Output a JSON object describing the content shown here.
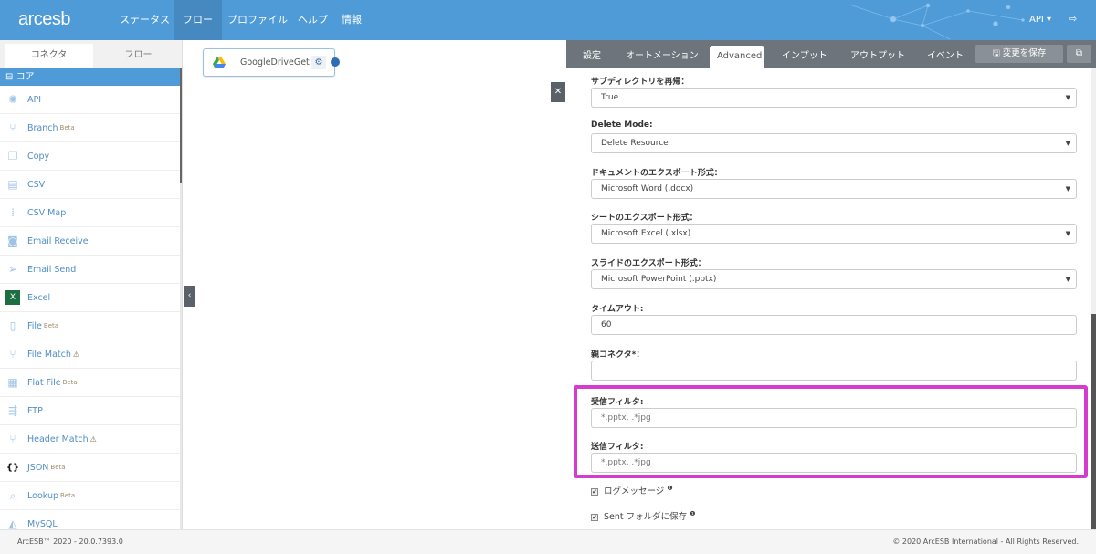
{
  "header": {
    "logo": "arcesb",
    "nav": [
      "ステータス",
      "フロー",
      "プロファイル",
      "ヘルプ",
      "情報"
    ],
    "active_nav": "フロー",
    "user_menu": "API ▾"
  },
  "left": {
    "tabs": [
      "コネクタ",
      "フロー"
    ],
    "section": "コア",
    "items": [
      {
        "label": "API",
        "icon": "api-icon",
        "glyph": "✺"
      },
      {
        "label": "Branch",
        "badge": "Beta",
        "icon": "branch-icon",
        "glyph": "⑂"
      },
      {
        "label": "Copy",
        "icon": "copy-icon",
        "glyph": "❐"
      },
      {
        "label": "CSV",
        "icon": "csv-icon",
        "glyph": "▤"
      },
      {
        "label": "CSV Map",
        "icon": "csv-map-icon",
        "glyph": "⁞"
      },
      {
        "label": "Email Receive",
        "icon": "email-receive-icon",
        "glyph": "◙"
      },
      {
        "label": "Email Send",
        "icon": "email-send-icon",
        "glyph": "➢"
      },
      {
        "label": "Excel",
        "icon": "excel-icon",
        "glyph": "X"
      },
      {
        "label": "File",
        "badge": "Beta",
        "icon": "file-icon",
        "glyph": "▯"
      },
      {
        "label": "File Match",
        "warn": "⚠",
        "icon": "file-match-icon",
        "glyph": "⑂"
      },
      {
        "label": "Flat File",
        "badge": "Beta",
        "icon": "flat-file-icon",
        "glyph": "▦"
      },
      {
        "label": "FTP",
        "icon": "ftp-icon",
        "glyph": "⇶"
      },
      {
        "label": "Header Match",
        "warn": "⚠",
        "icon": "header-match-icon",
        "glyph": "⑂"
      },
      {
        "label": "JSON",
        "badge": "Beta",
        "icon": "json-icon",
        "glyph": "{}"
      },
      {
        "label": "Lookup",
        "badge": "Beta",
        "icon": "lookup-icon",
        "glyph": "⌕"
      },
      {
        "label": "MySQL",
        "icon": "mysql-icon",
        "glyph": "◭"
      }
    ]
  },
  "canvas": {
    "node": "GoogleDriveGet"
  },
  "right": {
    "tabs": [
      "設定",
      "オートメーション",
      "Advanced",
      "インプット",
      "アウトプット",
      "イベント"
    ],
    "active_tab": "Advanced",
    "save": "🖫 変更を保存",
    "fields": [
      {
        "label": "サブディレクトリを再帰：",
        "value": "True",
        "type": "select"
      },
      {
        "label": "Delete Mode:",
        "value": "Delete Resource",
        "type": "select"
      },
      {
        "label": "ドキュメントのエクスポート形式：",
        "value": "Microsoft Word (.docx)",
        "type": "select"
      },
      {
        "label": "シートのエクスポート形式：",
        "value": "Microsoft Excel (.xlsx)",
        "type": "select"
      },
      {
        "label": "スライドのエクスポート形式：",
        "value": "Microsoft PowerPoint (.pptx)",
        "type": "select"
      },
      {
        "label": "タイムアウト:",
        "value": "60",
        "type": "input"
      },
      {
        "label": "親コネクタ*：",
        "value": "",
        "type": "input"
      },
      {
        "label": "受信フィルタ:",
        "value": "*.pptx, .*jpg",
        "type": "input"
      },
      {
        "label": "送信フィルタ:",
        "value": "*.pptx, .*jpg",
        "type": "input"
      }
    ],
    "checkboxes": [
      {
        "label": "ログメッセージ",
        "checked": true
      },
      {
        "label": "Sent フォルダに保存",
        "checked": true
      }
    ]
  },
  "footer": {
    "version": "ArcESB™ 2020 - 20.0.7393.0",
    "copyright": "© 2020 ArcESB International - All Rights Reserved."
  },
  "colors": {
    "header": "#4f9bd8",
    "highlight": "#d63bcf",
    "tabbar": "#6d747b"
  }
}
